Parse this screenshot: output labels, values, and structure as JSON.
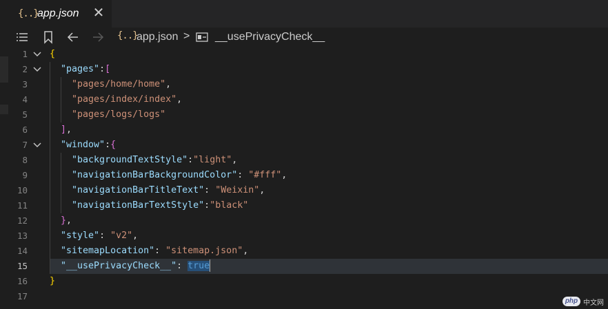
{
  "tab": {
    "icon": "{..}",
    "label": "app.json",
    "close": "✕"
  },
  "breadcrumb": {
    "icon": "{..}",
    "file": "app.json",
    "separator": ">",
    "symbol": "__usePrivacyCheck__"
  },
  "editor": {
    "active_line": 15,
    "line_numbers": [
      "1",
      "2",
      "3",
      "4",
      "5",
      "6",
      "7",
      "8",
      "9",
      "10",
      "11",
      "12",
      "13",
      "14",
      "15",
      "16",
      "17"
    ],
    "lines": [
      [
        {
          "t": "{",
          "c": "b1"
        }
      ],
      [
        {
          "t": "  "
        },
        {
          "t": "\"pages\"",
          "c": "k"
        },
        {
          "t": ":",
          "c": "p"
        },
        {
          "t": "[",
          "c": "b2"
        }
      ],
      [
        {
          "t": "    "
        },
        {
          "t": "\"pages/home/home\"",
          "c": "s"
        },
        {
          "t": ",",
          "c": "p"
        }
      ],
      [
        {
          "t": "    "
        },
        {
          "t": "\"pages/index/index\"",
          "c": "s"
        },
        {
          "t": ",",
          "c": "p"
        }
      ],
      [
        {
          "t": "    "
        },
        {
          "t": "\"pages/logs/logs\"",
          "c": "s"
        }
      ],
      [
        {
          "t": "  "
        },
        {
          "t": "]",
          "c": "b2"
        },
        {
          "t": ",",
          "c": "p"
        }
      ],
      [
        {
          "t": "  "
        },
        {
          "t": "\"window\"",
          "c": "k"
        },
        {
          "t": ":",
          "c": "p"
        },
        {
          "t": "{",
          "c": "b2"
        }
      ],
      [
        {
          "t": "    "
        },
        {
          "t": "\"backgroundTextStyle\"",
          "c": "k"
        },
        {
          "t": ":",
          "c": "p"
        },
        {
          "t": "\"light\"",
          "c": "s"
        },
        {
          "t": ",",
          "c": "p"
        }
      ],
      [
        {
          "t": "    "
        },
        {
          "t": "\"navigationBarBackgroundColor\"",
          "c": "k"
        },
        {
          "t": ": ",
          "c": "p"
        },
        {
          "t": "\"#fff\"",
          "c": "s"
        },
        {
          "t": ",",
          "c": "p"
        }
      ],
      [
        {
          "t": "    "
        },
        {
          "t": "\"navigationBarTitleText\"",
          "c": "k"
        },
        {
          "t": ": ",
          "c": "p"
        },
        {
          "t": "\"Weixin\"",
          "c": "s"
        },
        {
          "t": ",",
          "c": "p"
        }
      ],
      [
        {
          "t": "    "
        },
        {
          "t": "\"navigationBarTextStyle\"",
          "c": "k"
        },
        {
          "t": ":",
          "c": "p"
        },
        {
          "t": "\"black\"",
          "c": "s"
        }
      ],
      [
        {
          "t": "  "
        },
        {
          "t": "}",
          "c": "b2"
        },
        {
          "t": ",",
          "c": "p"
        }
      ],
      [
        {
          "t": "  "
        },
        {
          "t": "\"style\"",
          "c": "k"
        },
        {
          "t": ": ",
          "c": "p"
        },
        {
          "t": "\"v2\"",
          "c": "s"
        },
        {
          "t": ",",
          "c": "p"
        }
      ],
      [
        {
          "t": "  "
        },
        {
          "t": "\"sitemapLocation\"",
          "c": "k"
        },
        {
          "t": ": ",
          "c": "p"
        },
        {
          "t": "\"sitemap.json\"",
          "c": "s"
        },
        {
          "t": ",",
          "c": "p"
        }
      ],
      [
        {
          "t": "  "
        },
        {
          "t": "\"__usePrivacyCheck__\"",
          "c": "k"
        },
        {
          "t": ": ",
          "c": "p"
        },
        {
          "t": "true",
          "c": "kw sel"
        }
      ],
      [
        {
          "t": "}",
          "c": "b1"
        }
      ],
      []
    ],
    "folded_lines": [
      1,
      2,
      7
    ]
  },
  "watermark": {
    "logo": "php",
    "text": "中文网"
  },
  "colors": {
    "background": "#1e1e1e",
    "tab_bar": "#252526",
    "key": "#9cdcfe",
    "string": "#ce9178",
    "keyword": "#569cd6",
    "bracket_level1": "#ffd700",
    "bracket_level2": "#da70d6"
  }
}
